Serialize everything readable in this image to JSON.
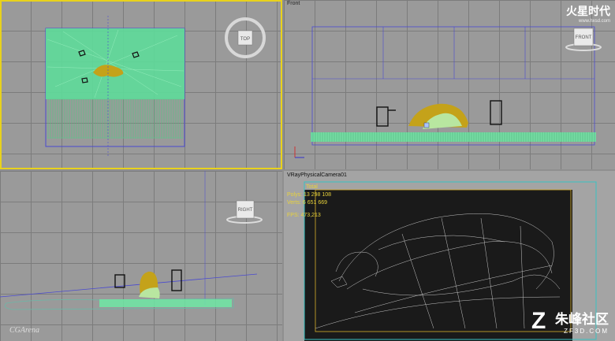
{
  "viewports": {
    "top": {
      "navcube_label": "TOP"
    },
    "front": {
      "label": "Front",
      "navcube_label": "FRONT"
    },
    "right": {
      "navcube_label": "RIGHT"
    },
    "persp": {
      "label": "VRayPhysicalCamera01",
      "stats": {
        "header": "Total",
        "polys_label": "Polys:",
        "polys_value": "13 298 108",
        "verts_label": "Verts:",
        "verts_value": "6 651 669",
        "fps_label": "FPS:",
        "fps_value": "473,213"
      }
    }
  },
  "watermarks": {
    "hx_brand": "火星时代",
    "hx_url": "www.hxsd.com",
    "cgarena": "CGArena",
    "zf_brand": "朱峰社区",
    "zf_url": "ZF3D.COM"
  },
  "colors": {
    "active_border": "#e9d21c",
    "stats_text": "#e8d23a",
    "grass": "#6ee8a5",
    "lion": "#c4a21a",
    "wire": "#5a5ad8"
  }
}
